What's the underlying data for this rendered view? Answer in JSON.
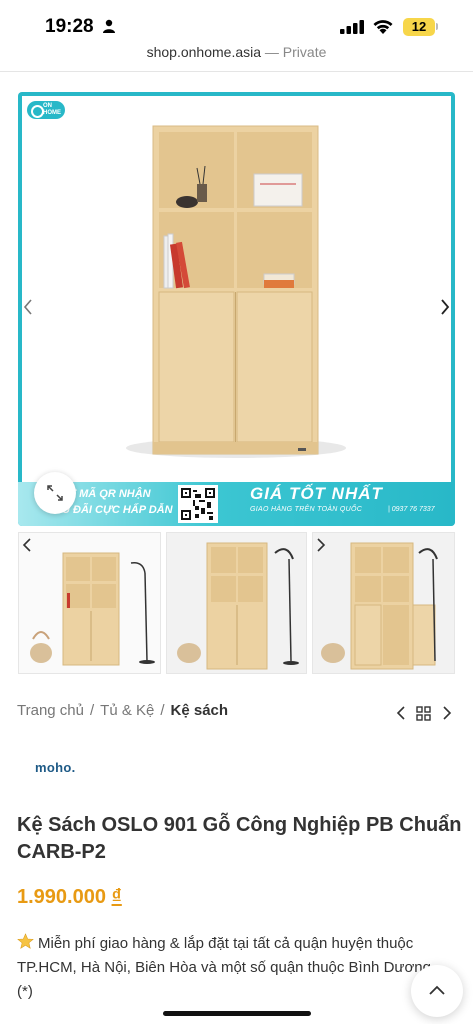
{
  "status_bar": {
    "time": "19:28",
    "battery": "12",
    "icons": [
      "person-icon",
      "signal-icon",
      "wifi-icon",
      "battery-icon"
    ]
  },
  "url_bar": {
    "host": "shop.onhome.asia",
    "private_label": "— Private"
  },
  "hero": {
    "logo_text_1": "ON",
    "logo_text_2": "HOME",
    "banner_left_line1": "ÉT MÃ QR NHẬN",
    "banner_left_line2": "U ĐÃI CỰC HẤP DẪN",
    "banner_title": "GIÁ TỐT NHẤT",
    "banner_subtitle": "GIAO HÀNG TRÊN TOÀN QUỐC",
    "banner_phone": "| 0937 76 7337"
  },
  "breadcrumb": {
    "items": [
      "Trang chủ",
      "Tủ & Kệ",
      "Kệ sách"
    ],
    "separator": "/"
  },
  "brand": {
    "logo_text": "moho."
  },
  "product": {
    "title": "Kệ Sách OSLO 901 Gỗ Công Nghiệp PB Chuẩn CARB-P2",
    "price": "1.990.000",
    "currency": "₫",
    "description": "Miễn phí giao hàng & lắp đặt tại tất cả quận huyện thuộc TP.HCM, Hà Nội, Biên Hòa và một số quận thuộc Bình Dương (*)"
  },
  "colors": {
    "accent": "#28b8c8",
    "price": "#e89a13",
    "wood": "#ecd2a2",
    "brand_text": "#1e5a86"
  }
}
